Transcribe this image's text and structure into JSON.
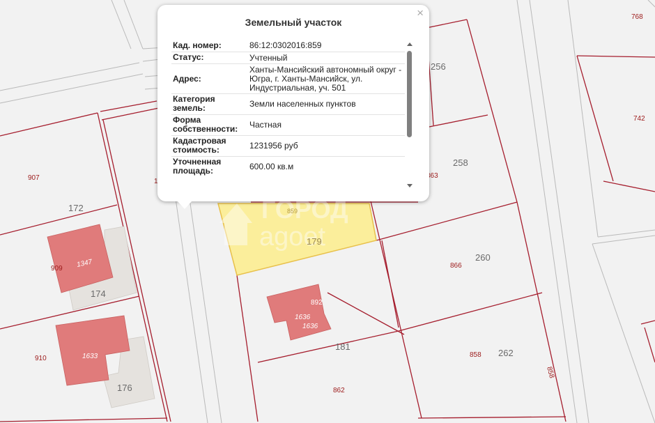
{
  "popup": {
    "title": "Земельный участок",
    "close_icon": "×",
    "rows": [
      {
        "label": "Кад. номер:",
        "value": "86:12:0302016:859"
      },
      {
        "label": "Статус:",
        "value": "Учтенный"
      },
      {
        "label": "Адрес:",
        "value": "Ханты-Мансийский автономный округ - Югра, г. Ханты-Мансийск, ул. Индустриальная, уч. 501"
      },
      {
        "label": "Категория земель:",
        "value": "Земли населенных пунктов"
      },
      {
        "label": "Форма собственности:",
        "value": "Частная"
      },
      {
        "label": "Кадастровая стоимость:",
        "value": "1231956 руб"
      },
      {
        "label": "Уточненная площадь:",
        "value": "600.00 кв.м"
      }
    ]
  },
  "map": {
    "colors": {
      "parcel_boundary": "#a51d2d",
      "parcel_label": "#9c1a1a",
      "building_fill": "#e07b7b",
      "selected_fill": "#fbee9b",
      "selected_stroke": "#e8c04a",
      "road_line": "#b9b9b9",
      "street_number": "#6a6a6a"
    },
    "parcel_labels": [
      "768",
      "742",
      "256",
      "258",
      "863",
      "907",
      "172",
      "909",
      "1347",
      "174",
      "910",
      "1633",
      "176",
      "859",
      "179",
      "892",
      "1636",
      "1636",
      "181",
      "866",
      "260",
      "858",
      "262",
      "858",
      "862",
      "1"
    ],
    "watermark": "ГОРОД agoet"
  }
}
